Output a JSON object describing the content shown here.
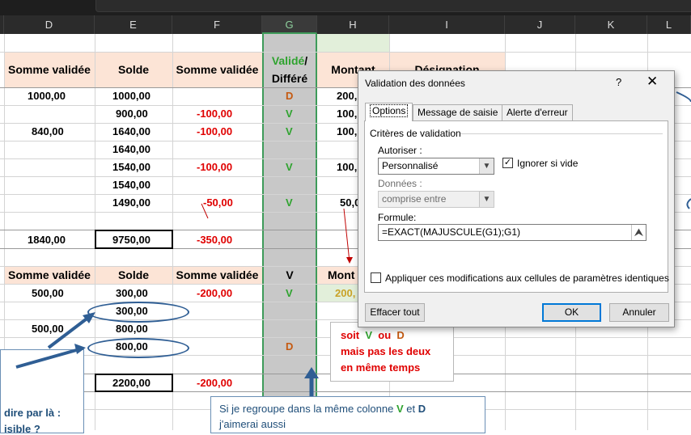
{
  "columns": [
    "D",
    "E",
    "F",
    "G",
    "H",
    "I",
    "J",
    "K",
    "L"
  ],
  "table1": {
    "headers": {
      "d": "Somme validée",
      "e": "Solde",
      "f": "Somme validée",
      "g1": "Validé",
      "g_slash": "/",
      "g2": "Différé",
      "h": "Montant",
      "i": "Désignation"
    },
    "rows": [
      {
        "d": "1000,00",
        "e": "1000,00",
        "f": "",
        "g": "D",
        "h": "200,"
      },
      {
        "d": "",
        "e": "900,00",
        "f": "-100,00",
        "g": "V",
        "h": "100,"
      },
      {
        "d": "840,00",
        "e": "1640,00",
        "f": "-100,00",
        "g": "V",
        "h": "100,"
      },
      {
        "d": "",
        "e": "1640,00",
        "f": "",
        "g": "",
        "h": ""
      },
      {
        "d": "",
        "e": "1540,00",
        "f": "-100,00",
        "g": "V",
        "h": "100,"
      },
      {
        "d": "",
        "e": "1540,00",
        "f": "",
        "g": "",
        "h": ""
      },
      {
        "d": "",
        "e": "1490,00",
        "f": "-50,00",
        "g": "V",
        "h": "50,0"
      }
    ],
    "totals": {
      "d": "1840,00",
      "e": "9750,00",
      "f": "-350,00"
    }
  },
  "table2": {
    "headers": {
      "d": "Somme validée",
      "e": "Solde",
      "f": "Somme validée",
      "g": "V",
      "h": "Mont"
    },
    "rows": [
      {
        "d": "500,00",
        "e": "300,00",
        "f": "-200,00",
        "g": "V",
        "h": "200,"
      },
      {
        "d": "",
        "e": "300,00",
        "f": "",
        "g": "",
        "h": ""
      },
      {
        "d": "500,00",
        "e": "800,00",
        "f": "",
        "g": "",
        "h": ""
      },
      {
        "d": "",
        "e": "800,00",
        "f": "",
        "g": "D",
        "h": ""
      }
    ],
    "totals": {
      "e": "2200,00",
      "f": "-200,00"
    }
  },
  "note1": {
    "p1": "soit",
    "v": "V",
    "ou": "ou",
    "d": "D",
    "line2": "mais pas les deux",
    "line3": "en même temps"
  },
  "note2": {
    "line1a": "Si je regroupe dans la même colonne",
    "v": "V",
    "et": "et",
    "d": "D",
    "line2": "j'aimerai aussi"
  },
  "note3": {
    "line1": "dire par là  :",
    "line2": "isible ?"
  },
  "dialog": {
    "title": "Validation des données",
    "help": "?",
    "close": "✕",
    "tabs": [
      "Options",
      "Message de saisie",
      "Alerte d'erreur"
    ],
    "criteria": "Critères de validation",
    "allow_label": "Autoriser :",
    "allow_value": "Personnalisé",
    "ignore_blank": "Ignorer si vide",
    "data_label": "Données :",
    "data_value": "comprise entre",
    "formula_label": "Formule:",
    "formula_value": "=EXACT(MAJUSCULE(G1);G1)",
    "apply_all": "Appliquer ces modifications aux cellules de paramètres identiques",
    "clear_all": "Effacer tout",
    "ok": "OK",
    "cancel": "Annuler"
  },
  "colors": {
    "green": "#2fa32f",
    "red": "#e00000",
    "orange": "#c55a11",
    "peach": "#fce4d6",
    "accent": "#3e9b5a",
    "shape": "#2f5e94"
  }
}
